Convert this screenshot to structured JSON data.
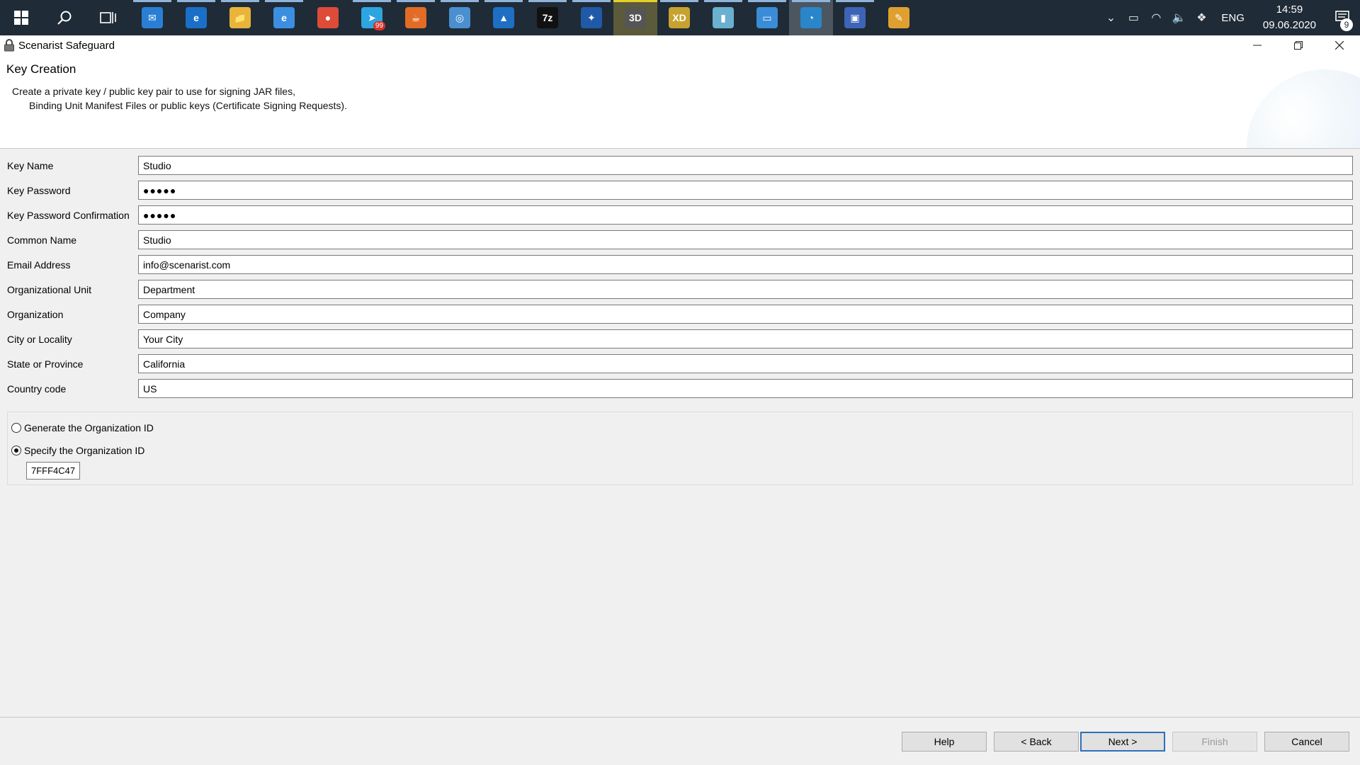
{
  "taskbar": {
    "apps": [
      {
        "name": "search-icon"
      },
      {
        "name": "task-view-icon"
      },
      {
        "name": "mail-icon",
        "label": "✉",
        "color": "#2a7fd4"
      },
      {
        "name": "edge-icon",
        "label": "e",
        "color": "#1b6fc6"
      },
      {
        "name": "file-explorer-icon",
        "label": "📁",
        "color": "#e8b43a"
      },
      {
        "name": "internet-explorer-icon",
        "label": "e",
        "color": "#3c8fe0"
      },
      {
        "name": "chrome-icon",
        "label": "●",
        "color": "#dd4b39"
      },
      {
        "name": "telegram-icon",
        "label": "➤",
        "color": "#2ca5e0",
        "badge": "99"
      },
      {
        "name": "java-icon",
        "label": "☕",
        "color": "#e26b25"
      },
      {
        "name": "disc-burner-icon",
        "label": "◎",
        "color": "#4a8fd0"
      },
      {
        "name": "photos-icon",
        "label": "▲",
        "color": "#1e6fc4"
      },
      {
        "name": "7zip-icon",
        "label": "7z",
        "color": "#111111"
      },
      {
        "name": "star-tool-icon",
        "label": "✦",
        "color": "#2059a8"
      },
      {
        "name": "clapper-icon",
        "label": "3D",
        "color": "#555555"
      },
      {
        "name": "xd-icon",
        "label": "XD",
        "color": "#c8a230"
      },
      {
        "name": "book-icon",
        "label": "▮",
        "color": "#6ab0cf"
      },
      {
        "name": "monitor-app-icon",
        "label": "▭",
        "color": "#3a8cd6"
      },
      {
        "name": "scenarist-icon",
        "label": "◔",
        "color": "#2a86c9"
      },
      {
        "name": "remote-desktop-icon",
        "label": "▣",
        "color": "#3e64b8"
      },
      {
        "name": "paint-icon",
        "label": "✎",
        "color": "#e0a030"
      }
    ],
    "language": "ENG",
    "time": "14:59",
    "date": "09.06.2020",
    "notification_count": "9"
  },
  "window": {
    "title": "Scenarist Safeguard"
  },
  "wizard": {
    "title": "Key Creation",
    "description_line1": "Create a private key / public key pair to use for signing JAR files,",
    "description_line2": "Binding Unit Manifest Files or public keys (Certificate Signing Requests)."
  },
  "form": {
    "key_name_label": "Key Name",
    "key_name_value": "Studio",
    "key_password_label": "Key Password",
    "key_password_value": "●●●●●",
    "key_password_confirm_label": "Key Password Confirmation",
    "key_password_confirm_value": "●●●●●",
    "common_name_label": "Common Name",
    "common_name_value": "Studio",
    "email_label": "Email Address",
    "email_value": "info@scenarist.com",
    "org_unit_label": "Organizational Unit",
    "org_unit_value": "Department",
    "organization_label": "Organization",
    "organization_value": "Company",
    "city_label": "City or Locality",
    "city_value": "Your City",
    "state_label": "State or Province",
    "state_value": "California",
    "country_label": "Country code",
    "country_value": "US"
  },
  "org_id": {
    "generate_label": "Generate the Organization ID",
    "specify_label": "Specify the Organization ID",
    "selected": "specify",
    "value": "7FFF4C47"
  },
  "buttons": {
    "help": "Help",
    "back": "< Back",
    "next": "Next >",
    "finish": "Finish",
    "cancel": "Cancel"
  }
}
